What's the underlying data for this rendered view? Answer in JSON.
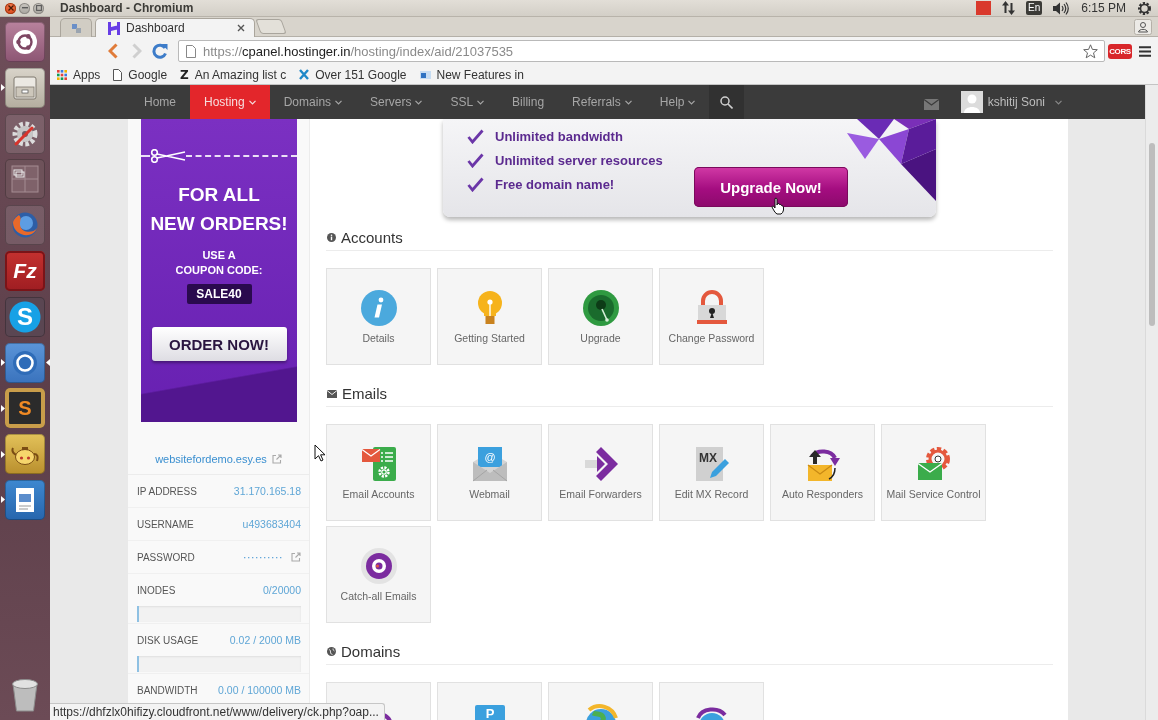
{
  "top_panel": {
    "title": "Dashboard - Chromium",
    "keyboard_layout": "En",
    "clock": "6:15 PM"
  },
  "launcher": {
    "apps": [
      {
        "kind": "dash",
        "running": false,
        "focused": false
      },
      {
        "kind": "files",
        "running": true,
        "focused": false
      },
      {
        "kind": "settings",
        "running": false,
        "focused": false
      },
      {
        "kind": "workspaces",
        "running": false,
        "focused": false
      },
      {
        "kind": "firefox",
        "running": false,
        "focused": false
      },
      {
        "kind": "filezilla",
        "glyph": "Fz",
        "running": false,
        "focused": false
      },
      {
        "kind": "skype",
        "glyph": "S",
        "running": false,
        "focused": false
      },
      {
        "kind": "chromium",
        "running": true,
        "focused": true
      },
      {
        "kind": "sublime",
        "glyph": "S",
        "running": true,
        "focused": false
      },
      {
        "kind": "teapot",
        "running": true,
        "focused": false
      },
      {
        "kind": "draw",
        "running": true,
        "focused": false
      }
    ]
  },
  "browser": {
    "tabs": [
      {
        "selected": false
      },
      {
        "label": "Dashboard",
        "selected": true
      }
    ],
    "url": {
      "scheme": "https://",
      "host": "cpanel.hostinger.in",
      "path": "/hosting/index/aid/21037535"
    },
    "extension_badge": "CORS",
    "bookmarks": [
      {
        "kind": "apps",
        "label": "Apps"
      },
      {
        "kind": "page",
        "label": "Google"
      },
      {
        "kind": "letter",
        "glyph": "Z",
        "label": "An Amazing list c"
      },
      {
        "kind": "cross",
        "label": "Over 151 Google"
      },
      {
        "kind": "site",
        "label": "New Features in"
      }
    ],
    "status_url": "https://dhfzlx0hifizy.cloudfront.net/www/delivery/ck.php?oap..."
  },
  "nav": {
    "items": [
      {
        "label": "Home",
        "dropdown": false,
        "selected": false
      },
      {
        "label": "Hosting",
        "dropdown": true,
        "selected": true
      },
      {
        "label": "Domains",
        "dropdown": true,
        "selected": false
      },
      {
        "label": "Servers",
        "dropdown": true,
        "selected": false
      },
      {
        "label": "SSL",
        "dropdown": true,
        "selected": false
      },
      {
        "label": "Billing",
        "dropdown": false,
        "selected": false
      },
      {
        "label": "Referrals",
        "dropdown": true,
        "selected": false
      },
      {
        "label": "Help",
        "dropdown": true,
        "selected": false
      }
    ],
    "user": {
      "name": "kshitij Soni"
    }
  },
  "sidebar": {
    "promo": {
      "headline": [
        "FOR ALL",
        "NEW ORDERS!"
      ],
      "subline": [
        "USE A",
        "COUPON CODE:"
      ],
      "code": "SALE40",
      "button": "ORDER NOW!"
    },
    "site_link": "websitefordemo.esy.es",
    "details": [
      {
        "kind": "text",
        "label": "IP ADDRESS",
        "value": "31.170.165.18"
      },
      {
        "kind": "text",
        "label": "USERNAME",
        "value": "u493683404"
      },
      {
        "kind": "secret",
        "label": "PASSWORD",
        "value": "··········"
      },
      {
        "kind": "usage",
        "label": "INODES",
        "value": "0/20000",
        "level": 0
      },
      {
        "kind": "usage",
        "label": "DISK USAGE",
        "value": "0.02 / 2000 MB",
        "level": 0
      },
      {
        "kind": "text",
        "label": "BANDWIDTH",
        "value": "0.00 / 100000 MB"
      }
    ]
  },
  "main": {
    "upgrade": {
      "features": [
        "Unlimited bandwidth",
        "Unlimited server resources",
        "Free domain name!"
      ],
      "button": "Upgrade Now!"
    },
    "sections": [
      {
        "kind": "info",
        "title": "Accounts",
        "tiles": [
          {
            "kind": "details",
            "label": "Details"
          },
          {
            "kind": "getting-started",
            "label": "Getting Started"
          },
          {
            "kind": "upgrade",
            "label": "Upgrade"
          },
          {
            "kind": "password",
            "label": "Change Password"
          }
        ]
      },
      {
        "kind": "mail",
        "title": "Emails",
        "tiles": [
          {
            "kind": "email-accounts",
            "label": "Email Accounts"
          },
          {
            "kind": "webmail",
            "glyph": "@",
            "label": "Webmail"
          },
          {
            "kind": "forwarders",
            "label": "Email Forwarders"
          },
          {
            "kind": "mx",
            "glyph": "MX",
            "label": "Edit MX Record"
          },
          {
            "kind": "autoresponders",
            "label": "Auto Responders"
          },
          {
            "kind": "mail-control",
            "label": "Mail Service Control"
          },
          {
            "kind": "catch-all",
            "label": "Catch-all Emails"
          }
        ]
      },
      {
        "kind": "globe",
        "title": "Domains",
        "tiles": [
          {
            "kind": "redirect"
          },
          {
            "kind": "parked",
            "glyph": "P"
          },
          {
            "kind": "globe"
          },
          {
            "kind": "globe-arrow"
          }
        ]
      }
    ]
  }
}
